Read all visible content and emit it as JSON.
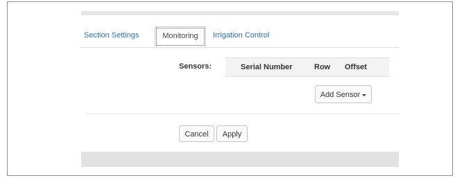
{
  "tabs": {
    "section_settings": "Section Settings",
    "monitoring": "Monitoring",
    "irrigation_control": "Irrigation Control",
    "active": "Monitoring"
  },
  "sensors": {
    "label": "Sensors:",
    "columns": [
      "Serial Number",
      "Row",
      "Offset"
    ],
    "rows": []
  },
  "buttons": {
    "add_sensor": "Add Sensor",
    "cancel": "Cancel",
    "apply": "Apply"
  },
  "colors": {
    "link": "#2a6ebb",
    "header_bg": "#f3f3f3",
    "strip_bg": "#e2e2e2"
  }
}
